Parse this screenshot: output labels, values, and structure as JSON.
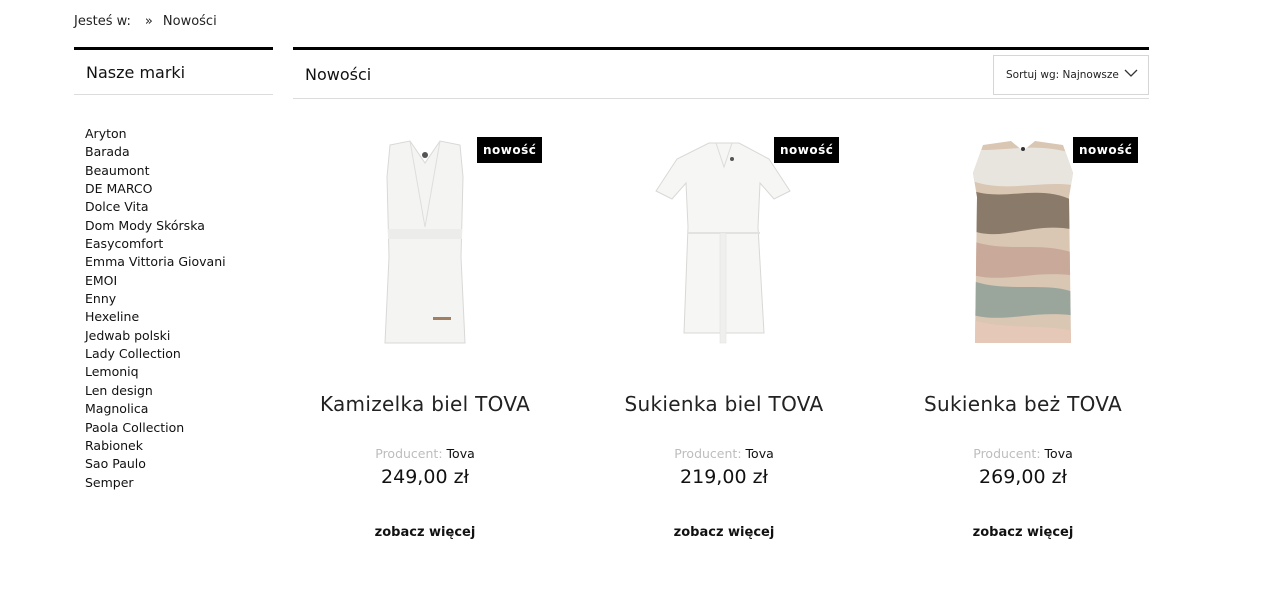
{
  "breadcrumb": {
    "prefix": "Jesteś w:",
    "separator": "»",
    "current": "Nowości"
  },
  "sidebar": {
    "title": "Nasze marki",
    "brands": [
      "Aryton",
      "Barada",
      "Beaumont",
      "DE MARCO",
      "Dolce Vita",
      "Dom Mody Skórska",
      "Easycomfort",
      "Emma Vittoria Giovani",
      "EMOI",
      "Enny",
      "Hexeline",
      "Jedwab polski",
      "Lady Collection",
      "Lemoniq",
      "Len design",
      "Magnolica",
      "Paola Collection",
      "Rabionek",
      "Sao Paulo",
      "Semper"
    ]
  },
  "main": {
    "title": "Nowości",
    "sort": {
      "label": "Sortuj wg: Najnowsze"
    }
  },
  "products": [
    {
      "badge": "nowość",
      "name": "Kamizelka biel TOVA",
      "producer_label": "Producent:",
      "producer": "Tova",
      "price": "249,00 zł",
      "more": "zobacz więcej"
    },
    {
      "badge": "nowość",
      "name": "Sukienka biel TOVA",
      "producer_label": "Producent:",
      "producer": "Tova",
      "price": "219,00 zł",
      "more": "zobacz więcej"
    },
    {
      "badge": "nowość",
      "name": "Sukienka beż TOVA",
      "producer_label": "Producent:",
      "producer": "Tova",
      "price": "269,00 zł",
      "more": "zobacz więcej"
    }
  ]
}
